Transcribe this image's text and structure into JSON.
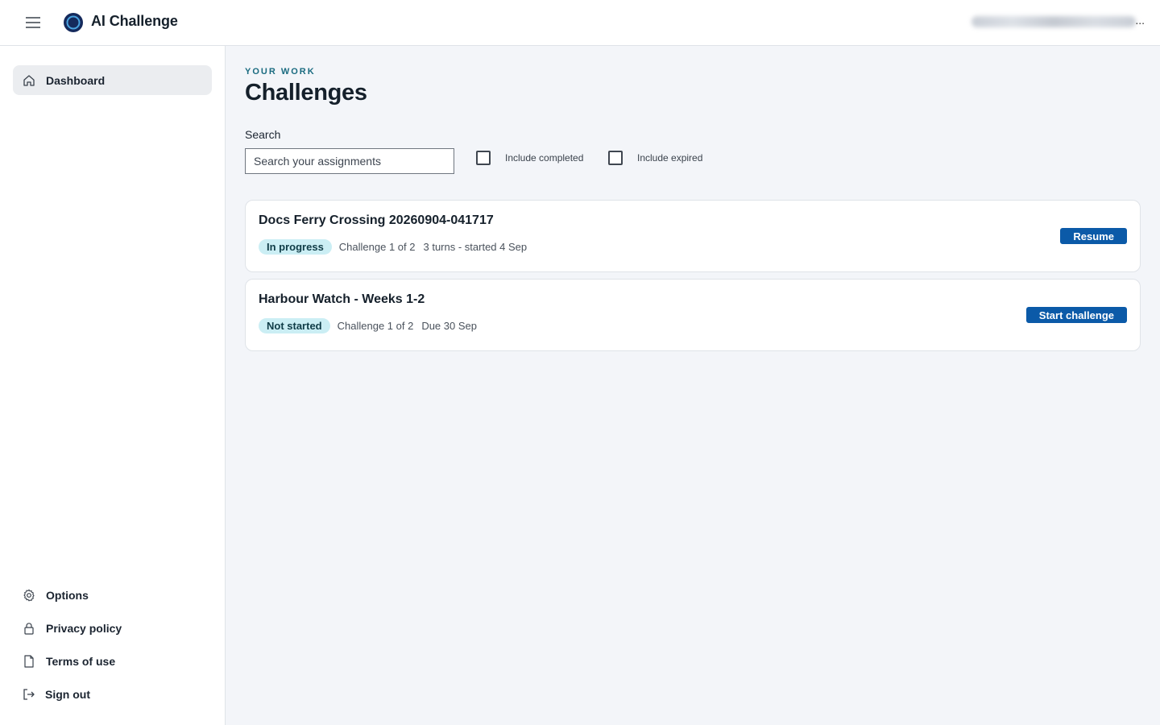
{
  "header": {
    "app_title": "AI Challenge",
    "user_ellipsis": "..."
  },
  "sidebar": {
    "dashboard_label": "Dashboard",
    "bottom_items": [
      {
        "label": "Options",
        "icon": "gear-icon"
      },
      {
        "label": "Privacy policy",
        "icon": "lock-icon"
      },
      {
        "label": "Terms of use",
        "icon": "document-icon"
      },
      {
        "label": "Sign out",
        "icon": "sign-out-icon"
      }
    ]
  },
  "main": {
    "eyebrow": "YOUR WORK",
    "title": "Challenges",
    "search": {
      "label": "Search",
      "placeholder": "Search your assignments",
      "value": ""
    },
    "filters": [
      {
        "label": "Include completed",
        "checked": false
      },
      {
        "label": "Include expired",
        "checked": false
      }
    ],
    "cards": [
      {
        "title": "Docs Ferry Crossing 20260904-041717",
        "status": "In progress",
        "progress": "Challenge 1 of 2",
        "detail": "3 turns - started 4 Sep",
        "action": "Resume"
      },
      {
        "title": "Harbour Watch - Weeks 1-2",
        "status": "Not started",
        "progress": "Challenge 1 of 2",
        "detail": "Due 30 Sep",
        "action": "Start challenge"
      }
    ]
  },
  "colors": {
    "accent": "#0b5aa8",
    "eyebrow": "#1a6b80",
    "badge_bg": "#cbeef4",
    "page_bg": "#f3f5f9"
  }
}
